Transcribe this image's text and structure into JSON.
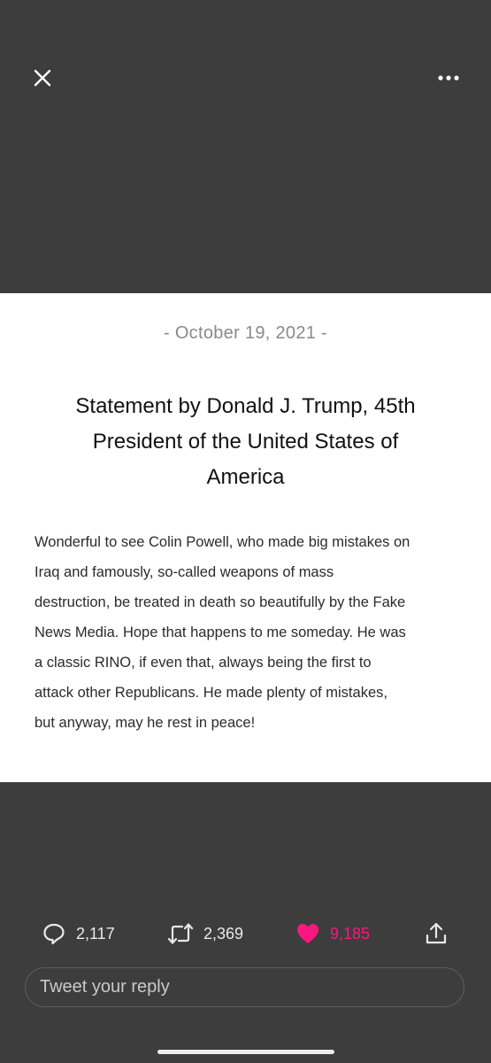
{
  "header": {
    "close_icon": "close-icon",
    "more_icon": "more-horizontal-icon"
  },
  "statement": {
    "date": "- October 19, 2021 -",
    "title_lines": [
      "Statement by Donald J. Trump, 45th",
      "President of the United States of",
      "America"
    ],
    "body_lines": [
      "Wonderful to see Colin Powell, who made big mistakes on",
      "Iraq and famously, so-called weapons of mass",
      "destruction, be treated in death so beautifully by the Fake",
      "News Media. Hope that happens to me someday. He was",
      "a classic RINO, if even that, always being the first to",
      "attack other Republicans. He made plenty of mistakes,",
      "but anyway, may he rest in peace!"
    ]
  },
  "actions": {
    "reply_count": "2,117",
    "retweet_count": "2,369",
    "like_count": "9,185",
    "like_color": "#f91880",
    "icons": [
      "reply-icon",
      "retweet-icon",
      "heart-icon",
      "share-icon"
    ]
  },
  "reply": {
    "placeholder": "Tweet your reply"
  }
}
